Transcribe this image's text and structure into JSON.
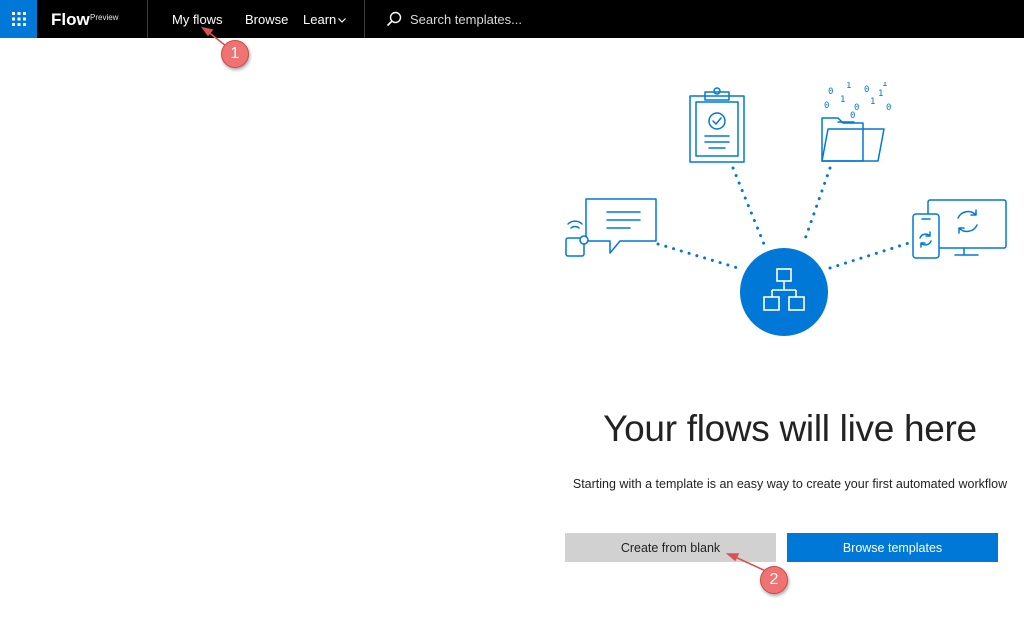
{
  "header": {
    "brand": "Flow",
    "brand_tag": "Preview",
    "nav": {
      "my_flows": "My flows",
      "browse": "Browse",
      "learn": "Learn"
    },
    "search_placeholder": "Search templates...",
    "accent_color": "#0078d7"
  },
  "illustration": {
    "binary_digits": [
      "0",
      "1",
      "0",
      "1",
      "0",
      "1",
      "0",
      "1",
      "0",
      "0",
      "1"
    ]
  },
  "main": {
    "headline": "Your flows will live here",
    "subtext": "Starting with a template is an easy way to create your first automated workflow",
    "create_blank_label": "Create from blank",
    "browse_templates_label": "Browse templates"
  },
  "annotations": {
    "marker_1": "1",
    "marker_2": "2"
  }
}
